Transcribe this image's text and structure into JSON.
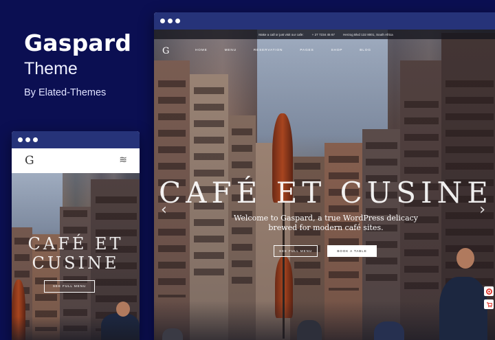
{
  "promo": {
    "title": "Gaspard",
    "subtitle": "Theme",
    "byline": "By Elated-Themes"
  },
  "desktop": {
    "topbar": {
      "call_text": "Make a call or just visit our cafe:",
      "phone": "+ 27 7234 45 67",
      "address": "Herzog Blvd 132 8001, South Africa"
    },
    "nav": {
      "logo": "G",
      "items": [
        "HOME",
        "MENU",
        "RESERVATION",
        "PAGES",
        "SHOP",
        "BLOG"
      ]
    },
    "hero": {
      "title": "CAFÉ ET CUSINE",
      "text_line1": "Welcome to Gaspard, a true WordPress delicacy",
      "text_line2": "brewed for modern café sites.",
      "btn_menu": "SEE FULL MENU",
      "btn_book": "BOOK A TABLE",
      "prev_arrow": "‹",
      "next_arrow": "›"
    },
    "side_icons": [
      "lifebuoy-icon",
      "cart-icon"
    ]
  },
  "mobile": {
    "logo": "G",
    "menu_icon": "≋",
    "title_line1": "CAFÉ ET",
    "title_line2": "CUSINE",
    "btn_menu": "SEE FULL MENU"
  },
  "colors": {
    "background": "#0b0f52",
    "window_bar": "#263379",
    "accent_red": "#e1342b"
  }
}
